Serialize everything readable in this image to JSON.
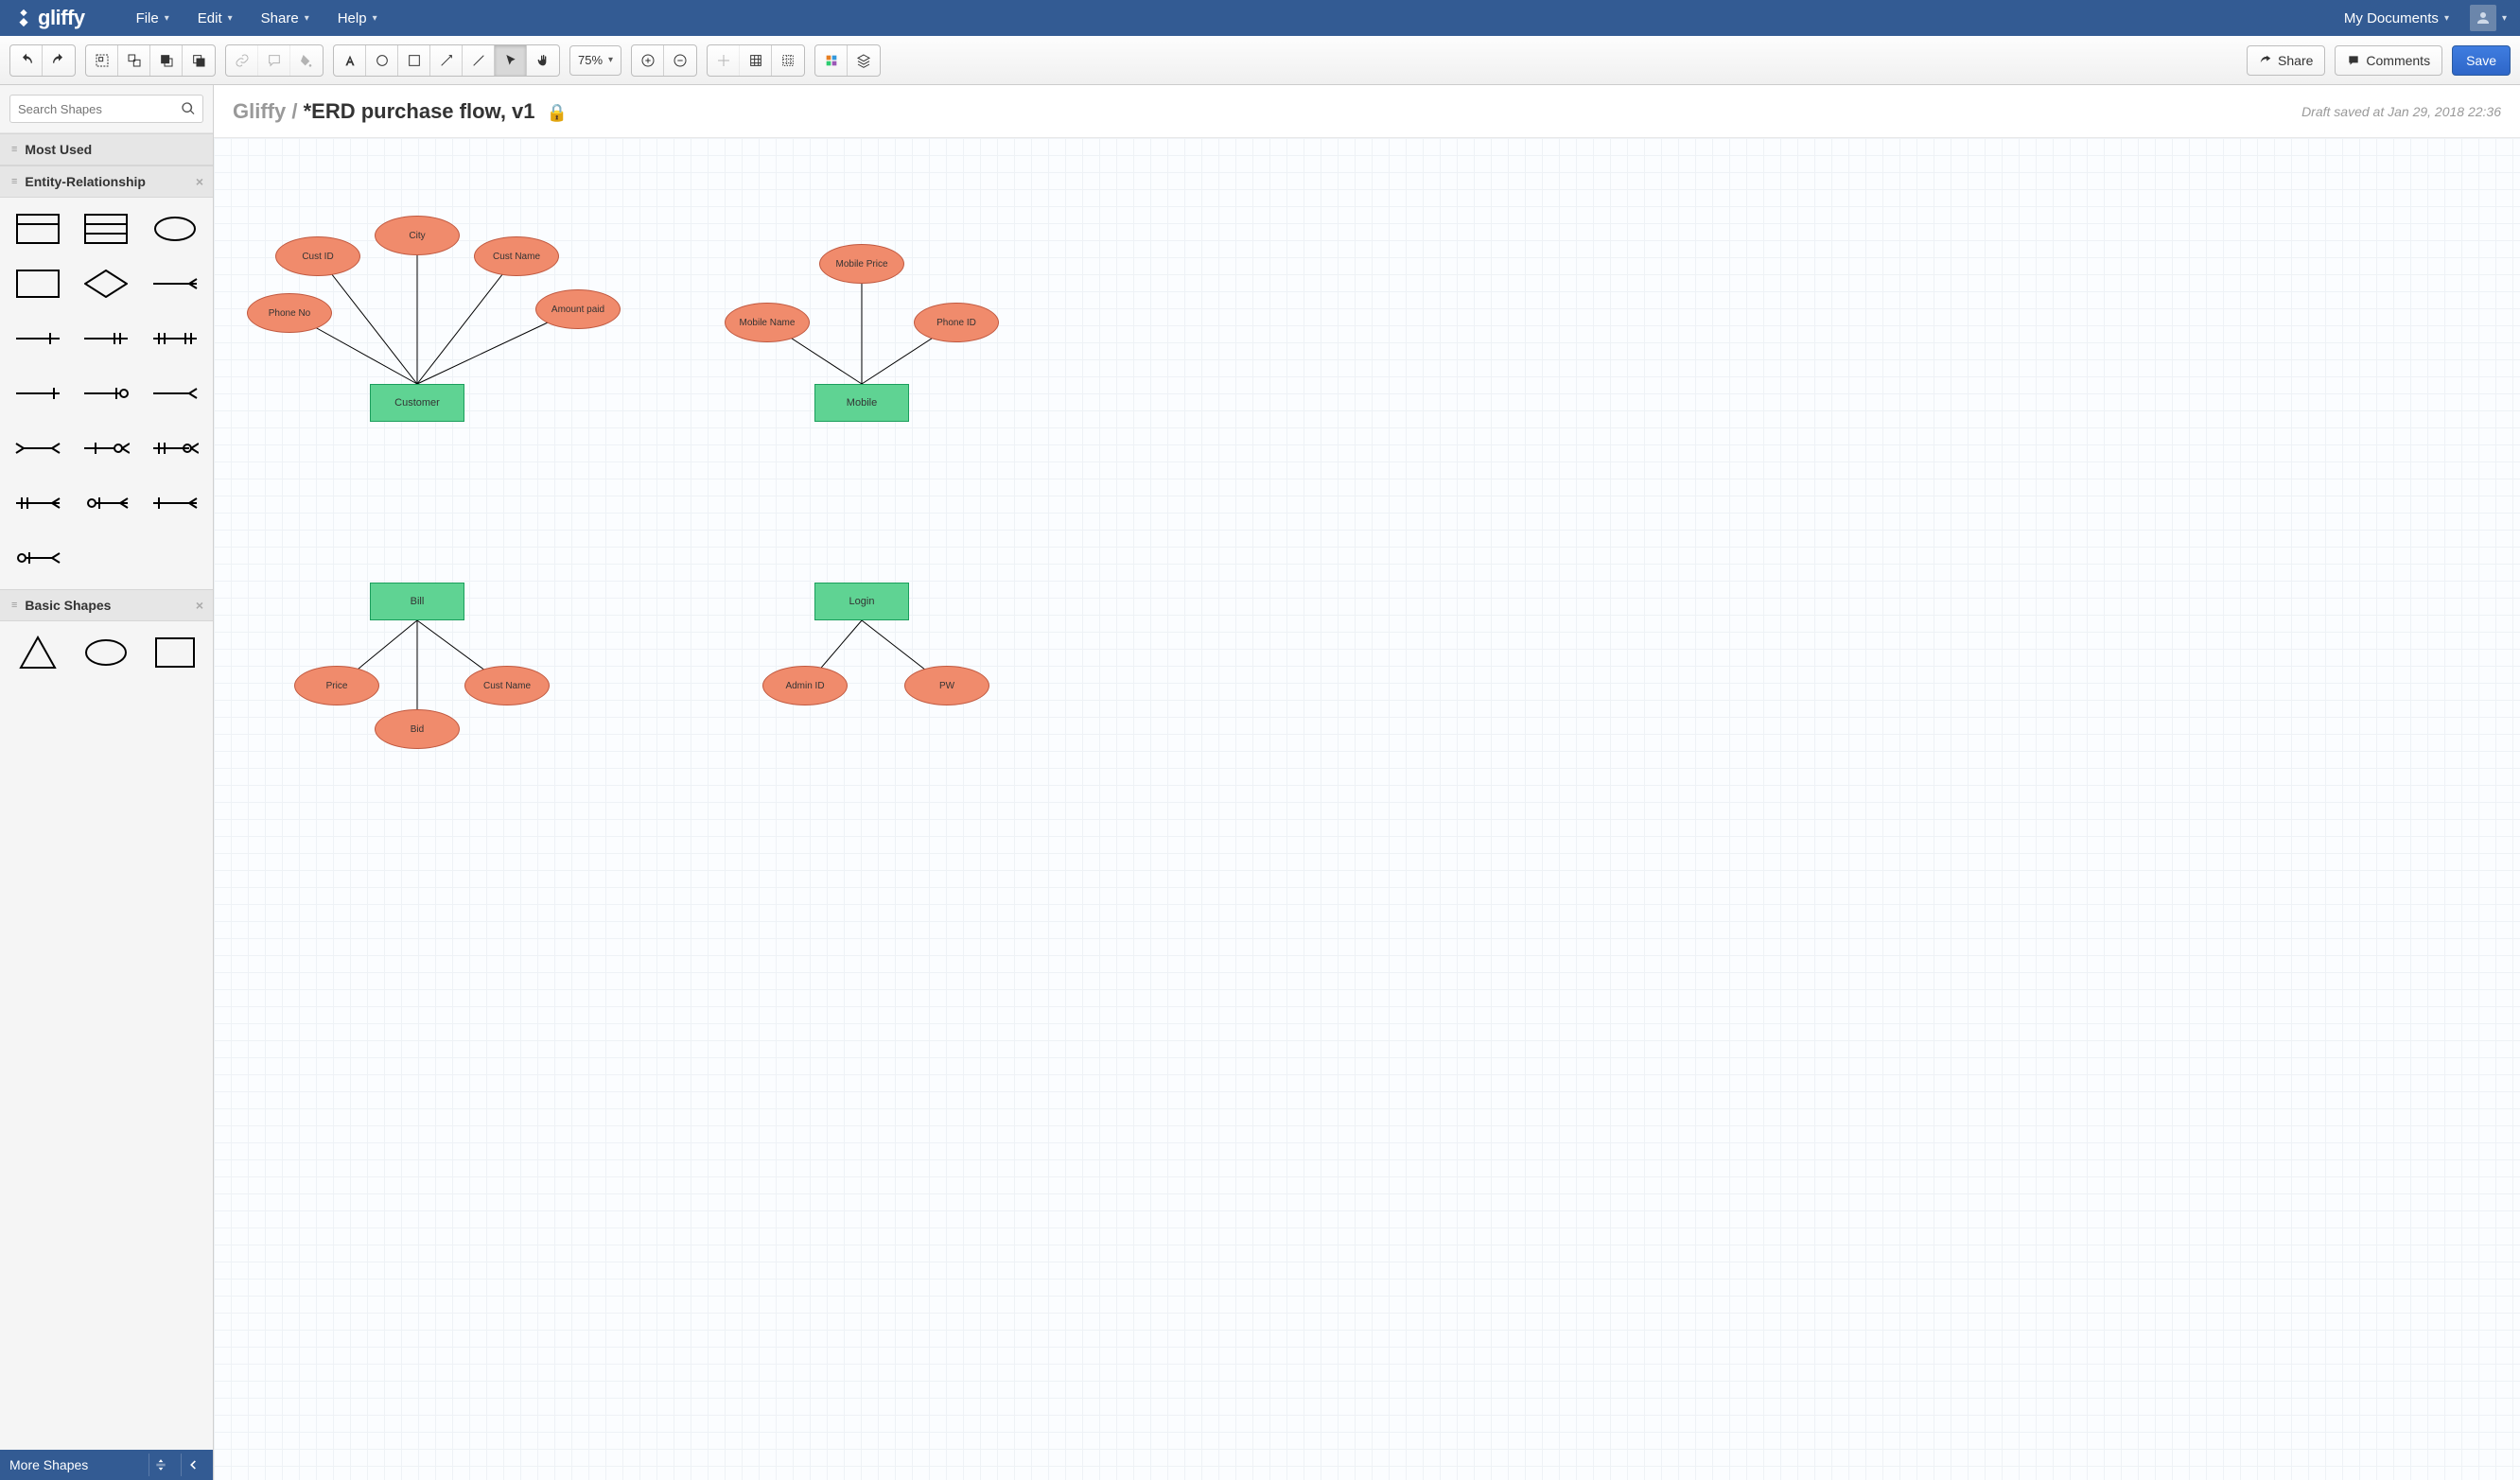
{
  "app": {
    "name": "gliffy"
  },
  "menubar": {
    "items": [
      "File",
      "Edit",
      "Share",
      "Help"
    ],
    "my_documents": "My Documents"
  },
  "toolbar": {
    "zoom": "75%",
    "share": "Share",
    "comments": "Comments",
    "save": "Save"
  },
  "sidebar": {
    "search_placeholder": "Search Shapes",
    "sections": {
      "most_used": "Most Used",
      "entity_relationship": "Entity-Relationship",
      "basic_shapes": "Basic Shapes"
    },
    "more_shapes": "More Shapes"
  },
  "document": {
    "breadcrumb_root": "Gliffy",
    "title": "*ERD purchase flow, v1",
    "draft_status": "Draft saved at Jan 29, 2018 22:36"
  },
  "diagram": {
    "entities": {
      "customer": "Customer",
      "mobile": "Mobile",
      "bill": "Bill",
      "login": "Login"
    },
    "attributes": {
      "cust_id": "Cust ID",
      "city": "City",
      "cust_name": "Cust Name",
      "phone_no": "Phone No",
      "amount_paid": "Amount paid",
      "mobile_name": "Mobile Name",
      "mobile_price": "Mobile Price",
      "phone_id": "Phone ID",
      "price": "Price",
      "bid": "Bid",
      "cust_name2": "Cust Name",
      "admin_id": "Admin ID",
      "pw": "PW"
    }
  }
}
